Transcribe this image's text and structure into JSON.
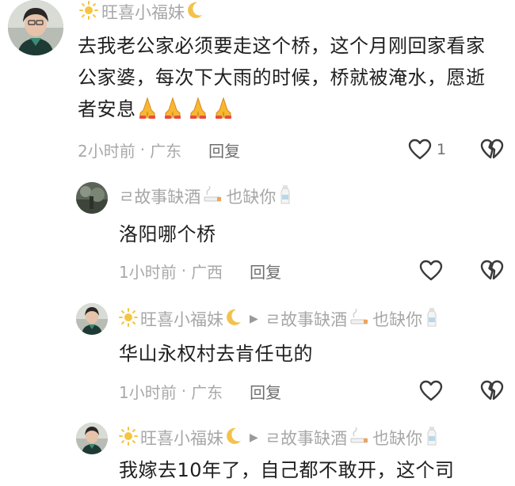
{
  "comments": [
    {
      "author": "旺喜小福妹",
      "author_prefix_icon": "sun-icon",
      "author_suffix_icon": "crescent-moon-icon",
      "text": "去我老公家必须要走这个桥，这个月刚回家看家公家婆，每次下大雨的时候，桥就被淹水，愿逝者安息",
      "emoji": [
        "folded-hands-icon",
        "folded-hands-icon",
        "folded-hands-icon",
        "folded-hands-icon"
      ],
      "time": "2小时前",
      "separator": "·",
      "location": "广东",
      "reply_label": "回复",
      "like_count": "1"
    },
    {
      "author": "ㄹ故事缺酒",
      "author_suffix_icon": "cigarette-icon",
      "author_tail": "也缺你",
      "author_tail_icon": "milk-bottle-icon",
      "text": "洛阳哪个桥",
      "time": "1小时前",
      "separator": "·",
      "location": "广西",
      "reply_label": "回复"
    },
    {
      "author": "旺喜小福妹",
      "author_prefix_icon": "sun-icon",
      "author_suffix_icon": "crescent-moon-icon",
      "reply_to": "ㄹ故事缺酒",
      "reply_to_icon": "cigarette-icon",
      "reply_to_tail": "也缺你",
      "reply_to_tail_icon": "milk-bottle-icon",
      "text": "华山永权村去肯任屯的",
      "time": "1小时前",
      "separator": "·",
      "location": "广东",
      "reply_label": "回复"
    },
    {
      "author": "旺喜小福妹",
      "author_prefix_icon": "sun-icon",
      "author_suffix_icon": "crescent-moon-icon",
      "reply_to": "ㄹ故事缺酒",
      "reply_to_icon": "cigarette-icon",
      "reply_to_tail": "也缺你",
      "reply_to_tail_icon": "milk-bottle-icon",
      "text": "我嫁去10年了，自己都不敢开，这个司"
    }
  ],
  "colors": {
    "sun": "#f5c542",
    "moon": "#f3c24a",
    "praying": "#f7b733",
    "text": "#1f1f1f",
    "muted": "#a9a9a9",
    "icon_stroke": "#3a3a3a"
  }
}
